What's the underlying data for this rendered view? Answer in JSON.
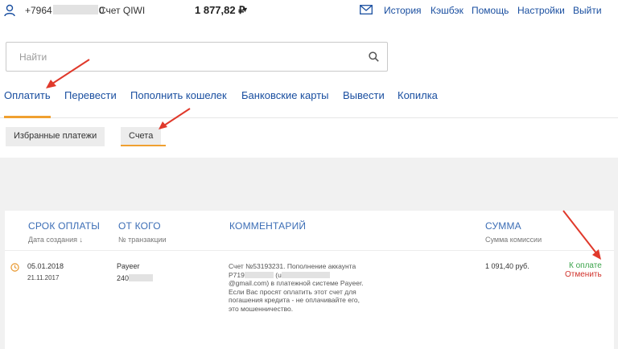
{
  "header": {
    "phone_prefix": "+7964",
    "phone_suffix": "0",
    "account_name": "Счет QIWI",
    "balance": "1 877,82 ₽",
    "nav": [
      "История",
      "Кэшбэк",
      "Помощь",
      "Настройки",
      "Выйти"
    ]
  },
  "search": {
    "placeholder": "Найти"
  },
  "tabs": [
    "Оплатить",
    "Перевести",
    "Пополнить кошелек",
    "Банковские карты",
    "Вывести",
    "Копилка"
  ],
  "subtabs": [
    "Избранные платежи",
    "Счета"
  ],
  "table": {
    "headers": [
      {
        "title": "СРОК ОПЛАТЫ",
        "subtitle": "Дата создания ↓"
      },
      {
        "title": "ОТ КОГО",
        "subtitle": "№ транзакции"
      },
      {
        "title": "КОММЕНТАРИЙ",
        "subtitle": ""
      },
      {
        "title": "СУММА",
        "subtitle": "Сумма комиссии"
      }
    ],
    "rows": [
      {
        "due_date": "05.01.2018",
        "created_date": "21.11.2017",
        "sender": "Payeer",
        "transaction_prefix": "240",
        "comment_part1": "Счет №53193231. Пополнение аккаунта P719",
        "comment_part2": "(u",
        "comment_part3": "@gmail.com) в платежной системе Payeer. Если Вас просят оплатить этот счет для погашения кредита - не оплачивайте его, это мошенничество.",
        "amount": "1 091,40 руб.",
        "pay_label": "К оплате",
        "cancel_label": "Отменить"
      }
    ]
  },
  "colors": {
    "accent_orange": "#f0a030",
    "link_blue": "#1a4fa0",
    "header_blue": "#3b6db5",
    "pay_green": "#3aa34a",
    "cancel_red": "#d0322b",
    "arrow_red": "#e0392b"
  }
}
